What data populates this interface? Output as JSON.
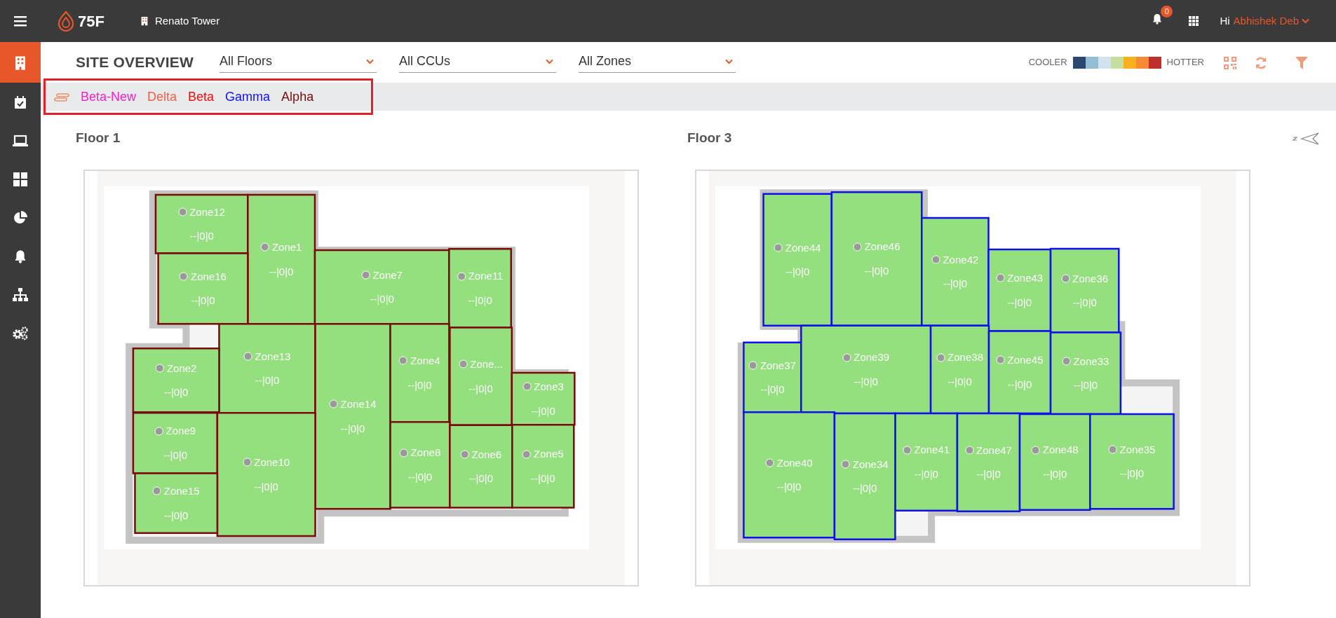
{
  "header": {
    "logo_text": "75F",
    "site": "Renato Tower",
    "notifications": "0",
    "greeting": "Hi",
    "user": "Abhishek Deb"
  },
  "sidebar": {
    "items": [
      {
        "selected": true
      },
      {
        "selected": false
      },
      {
        "selected": false
      },
      {
        "selected": false
      },
      {
        "selected": false
      },
      {
        "selected": false
      },
      {
        "selected": false
      },
      {
        "selected": false
      }
    ]
  },
  "page_title": "SITE OVERVIEW",
  "filters": [
    {
      "value": "All Floors"
    },
    {
      "value": "All CCUs"
    },
    {
      "value": "All Zones"
    }
  ],
  "heat_scale": {
    "low_label": "COOLER",
    "high_label": "HOTTER",
    "swatches": [
      {
        "color": "#2c4770"
      },
      {
        "color": "#93bfd4"
      },
      {
        "color": "#d3e2f0"
      },
      {
        "color": "#c6dea0"
      },
      {
        "color": "#f7b11f"
      },
      {
        "color": "#f68a35"
      },
      {
        "color": "#c0302a"
      }
    ]
  },
  "ccu_legend": [
    {
      "name": "Beta-New",
      "color": "#ee22cc"
    },
    {
      "name": "Delta",
      "color": "#f0604a"
    },
    {
      "name": "Beta",
      "color": "#ee1111"
    },
    {
      "name": "Gamma",
      "color": "#1111ee"
    },
    {
      "name": "Alpha",
      "color": "#7a0a0a"
    }
  ],
  "floors": [
    {
      "title": "Floor 1",
      "color": "#7a0a0a",
      "zones": [
        {
          "name": "Zone12",
          "reading": "--|0|0"
        },
        {
          "name": "Zone1",
          "reading": "--|0|0"
        },
        {
          "name": "Zone16",
          "reading": "--|0|0"
        },
        {
          "name": "Zone7",
          "reading": "--|0|0"
        },
        {
          "name": "Zone11",
          "reading": "--|0|0"
        },
        {
          "name": "Zone13",
          "reading": "--|0|0"
        },
        {
          "name": "Zone2",
          "reading": "--|0|0"
        },
        {
          "name": "Zone14",
          "reading": "--|0|0"
        },
        {
          "name": "Zone4",
          "reading": "--|0|0"
        },
        {
          "name": "Zone...",
          "reading": "--|0|0"
        },
        {
          "name": "Zone3",
          "reading": "--|0|0"
        },
        {
          "name": "Zone9",
          "reading": "--|0|0"
        },
        {
          "name": "Zone10",
          "reading": "--|0|0"
        },
        {
          "name": "Zone8",
          "reading": "--|0|0"
        },
        {
          "name": "Zone6",
          "reading": "--|0|0"
        },
        {
          "name": "Zone5",
          "reading": "--|0|0"
        },
        {
          "name": "Zone15",
          "reading": "--|0|0"
        }
      ]
    },
    {
      "title": "Floor 3",
      "color": "#1010ee",
      "zones": [
        {
          "name": "Zone44",
          "reading": "--|0|0"
        },
        {
          "name": "Zone46",
          "reading": "--|0|0"
        },
        {
          "name": "Zone42",
          "reading": "--|0|0"
        },
        {
          "name": "Zone43",
          "reading": "--|0|0"
        },
        {
          "name": "Zone36",
          "reading": "--|0|0"
        },
        {
          "name": "Zone37",
          "reading": "--|0|0"
        },
        {
          "name": "Zone39",
          "reading": "--|0|0"
        },
        {
          "name": "Zone38",
          "reading": "--|0|0"
        },
        {
          "name": "Zone45",
          "reading": "--|0|0"
        },
        {
          "name": "Zone33",
          "reading": "--|0|0"
        },
        {
          "name": "Zone41",
          "reading": "--|0|0"
        },
        {
          "name": "Zone47",
          "reading": "--|0|0"
        },
        {
          "name": "Zone48",
          "reading": "--|0|0"
        },
        {
          "name": "Zone35",
          "reading": "--|0|0"
        },
        {
          "name": "Zone40",
          "reading": "--|0|0"
        },
        {
          "name": "Zone34",
          "reading": "--|0|0"
        }
      ]
    }
  ]
}
